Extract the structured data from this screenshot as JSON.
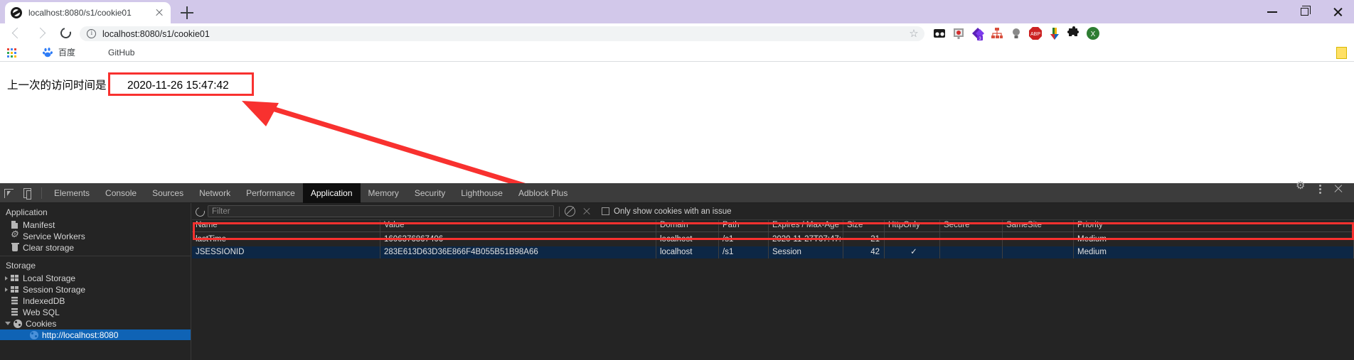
{
  "browser": {
    "tab": {
      "title": "localhost:8080/s1/cookie01",
      "favicon": "globe-icon",
      "close": "close-icon"
    },
    "new_tab_label": "+",
    "window_controls": {
      "minimize": "minimize-icon",
      "maximize": "maximize-icon",
      "close": "close-icon"
    },
    "nav": {
      "back": "back-arrow-icon",
      "forward": "forward-arrow-icon",
      "reload": "reload-icon"
    },
    "omnibox": {
      "value": "localhost:8080/s1/cookie01",
      "info_icon": "info-circle-icon",
      "bookmark": "star-icon"
    },
    "extensions": [
      {
        "name": "eyes-extension-icon",
        "color": "#1a1a1a"
      },
      {
        "name": "screen-recorder-icon",
        "color": "#8a8a8a"
      },
      {
        "name": "purple-diamond-icon",
        "color": "#7b2fbf",
        "badge": "3"
      },
      {
        "name": "sitemap-icon",
        "color": "#d94f3d"
      },
      {
        "name": "bulb-icon",
        "color": "#808080"
      },
      {
        "name": "adblock-icon",
        "color": "#cc2222",
        "label": "ABP"
      },
      {
        "name": "download-arrow-icon",
        "color": "#f2b705"
      },
      {
        "name": "puzzle-extensions-icon",
        "color": "#1a1a1a"
      },
      {
        "name": "profile-avatar-icon",
        "color": "#2e7d32"
      }
    ],
    "bookmarks": {
      "apps_grid": "apps-grid-icon",
      "items": [
        {
          "label": "百度",
          "icon": "baidu-paw-icon"
        },
        {
          "label": "GitHub",
          "icon": "github-icon"
        }
      ],
      "notepad_icon": "sticky-note-icon"
    }
  },
  "page": {
    "label": "上一次的访问时间是：",
    "timestamp": "2020-11-26 15:47:42"
  },
  "annotations": {
    "highlight_color": "#f8312f",
    "arrow": "red-arrow-pointing-from-cookie-row-to-timestamp"
  },
  "devtools": {
    "left_icons": [
      {
        "name": "inspect-element-icon"
      },
      {
        "name": "device-toolbar-icon"
      }
    ],
    "tabs": [
      {
        "label": "Elements",
        "active": false
      },
      {
        "label": "Console",
        "active": false
      },
      {
        "label": "Sources",
        "active": false
      },
      {
        "label": "Network",
        "active": false
      },
      {
        "label": "Performance",
        "active": false
      },
      {
        "label": "Application",
        "active": true
      },
      {
        "label": "Memory",
        "active": false
      },
      {
        "label": "Security",
        "active": false
      },
      {
        "label": "Lighthouse",
        "active": false
      },
      {
        "label": "Adblock Plus",
        "active": false
      }
    ],
    "right_icons": [
      {
        "name": "settings-gear-icon"
      },
      {
        "name": "more-options-kebab-icon"
      },
      {
        "name": "close-devtools-icon"
      }
    ],
    "sidebar": {
      "sections": [
        {
          "title": "Application",
          "items": [
            {
              "label": "Manifest",
              "icon": "document-icon",
              "indent": 1,
              "twisty": "none",
              "selected": false
            },
            {
              "label": "Service Workers",
              "icon": "gear-icon",
              "indent": 1,
              "twisty": "none",
              "selected": false
            },
            {
              "label": "Clear storage",
              "icon": "trash-icon",
              "indent": 1,
              "twisty": "none",
              "selected": false
            }
          ]
        },
        {
          "title": "Storage",
          "items": [
            {
              "label": "Local Storage",
              "icon": "table-icon",
              "indent": 1,
              "twisty": "collapsed",
              "selected": false
            },
            {
              "label": "Session Storage",
              "icon": "table-icon",
              "indent": 1,
              "twisty": "collapsed",
              "selected": false
            },
            {
              "label": "IndexedDB",
              "icon": "database-icon",
              "indent": 1,
              "twisty": "none",
              "selected": false
            },
            {
              "label": "Web SQL",
              "icon": "database-icon",
              "indent": 1,
              "twisty": "none",
              "selected": false
            },
            {
              "label": "Cookies",
              "icon": "cookie-icon",
              "indent": 1,
              "twisty": "expanded",
              "selected": false
            },
            {
              "label": "http://localhost:8080",
              "icon": "cookie-icon",
              "indent": 2,
              "twisty": "none",
              "selected": true
            }
          ]
        }
      ]
    },
    "cookies_panel": {
      "toolbar": {
        "refresh_icon": "refresh-icon",
        "filter_placeholder": "Filter",
        "filter_value": "",
        "clear_icon": "clear-all-icon",
        "delete_icon": "delete-selected-icon",
        "checkbox_label": "Only show cookies with an issue",
        "checkbox_checked": false
      },
      "columns": [
        "Name",
        "Value",
        "Domain",
        "Path",
        "Expires / Max-Age",
        "Size",
        "HttpOnly",
        "Secure",
        "SameSite",
        "Priority"
      ],
      "rows": [
        {
          "name": "lastTime",
          "value": "1606376867406",
          "domain": "localhost",
          "path": "/s1",
          "expires": "2020-11-27T07:47:47....",
          "size": "21",
          "httponly": "",
          "secure": "",
          "samesite": "",
          "priority": "Medium",
          "selected": false,
          "highlighted": true
        },
        {
          "name": "JSESSIONID",
          "value": "283E613D63D36E866F4B055B51B98A66",
          "domain": "localhost",
          "path": "/s1",
          "expires": "Session",
          "size": "42",
          "httponly": "✓",
          "secure": "",
          "samesite": "",
          "priority": "Medium",
          "selected": true,
          "highlighted": false
        }
      ]
    }
  }
}
